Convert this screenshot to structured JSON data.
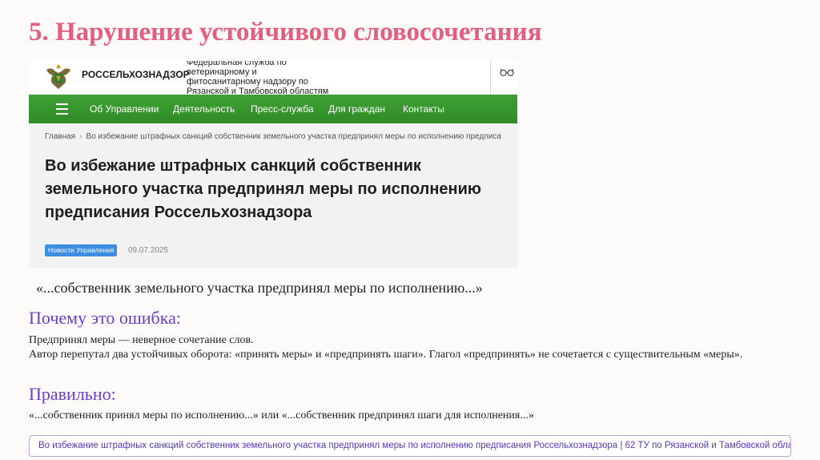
{
  "slide": {
    "title": "5. Нарушение устойчивого словосочетания"
  },
  "screenshot": {
    "brand": "РОССЕЛЬХОЗНАДЗОР",
    "agency_lines": [
      "Федеральная служба по",
      "ветеринарному и",
      "фитосанитарному надзору по",
      "Рязанской и Тамбовской областям"
    ],
    "nav": [
      "Об Управлении",
      "Деятельность",
      "Пресс-служба",
      "Для граждан",
      "Контакты"
    ],
    "breadcrumb": {
      "home": "Главная",
      "separator": "›",
      "current": "Во избежание штрафных санкций собственник земельного участка предпринял меры по исполнению предписа"
    },
    "article_title_lines": [
      "Во избежание штрафных санкций собственник",
      "земельного участка предпринял меры по исполнению",
      "предписания Россельхознадзора"
    ],
    "tag": "Новости Управления",
    "date": "09.07.2025",
    "colors": {
      "nav_green": "#3a9a30",
      "tag_blue": "#3d8de0"
    },
    "icons": {
      "emblem": "coat-of-arms-icon",
      "accessibility": "glasses-icon",
      "menu": "burger-menu-icon"
    }
  },
  "quote": "«...собственник земельного участка предпринял меры по исполнению...»",
  "why": {
    "heading": "Почему это ошибка:",
    "line1": "Предпринял меры — неверное сочетание слов.",
    "line2": "Автор перепутал два устойчивых оборота: «принять меры» и «предпринять шаги». Глагол «предпринять» не сочетается с существительным «меры»."
  },
  "correct": {
    "heading": "Правильно:",
    "text": "«...собственник принял меры по исполнению...» или «...собственник предпринял шаги для исполнения...»"
  },
  "link": {
    "text": "Во избежание штрафных санкций собственник земельного участка предпринял меры по исполнению предписания Россельхознадзора | 62 ТУ по Рязанской и Тамбовской облас"
  },
  "colors": {
    "title": "#e0607e",
    "heading": "#6a3fc8",
    "link": "#5a36b8"
  }
}
